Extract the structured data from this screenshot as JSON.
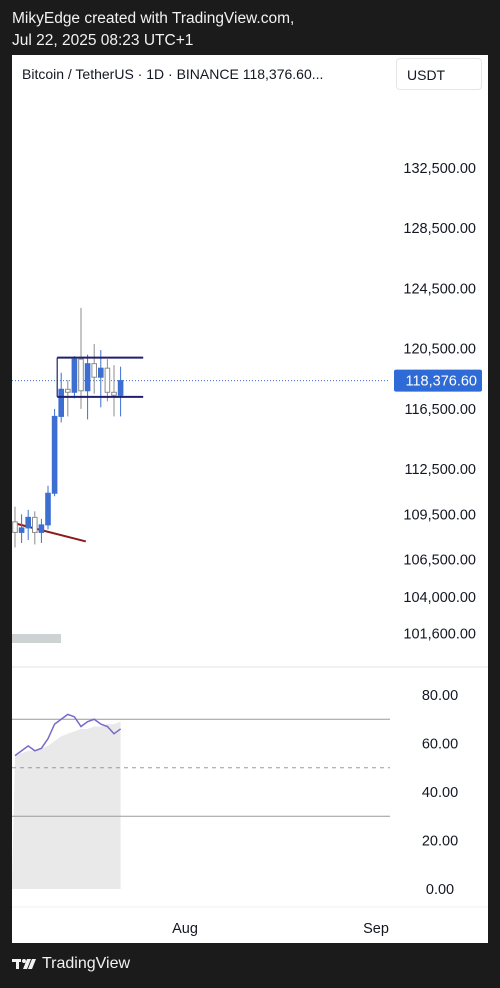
{
  "header": {
    "line1": "MikyEdge created with TradingView.com,",
    "line2": "Jul 22, 2025 08:23 UTC+1"
  },
  "chart_header": {
    "symbol": "Bitcoin / TetherUS · 1D · BINANCE  118,376.60...",
    "currency": "USDT"
  },
  "footer": {
    "brand": "TradingView"
  },
  "colors": {
    "up": "#3c6fd1",
    "down": "#8c8c8c",
    "rsi": "#7b68c8",
    "trendline": "#8b1a1a",
    "rectangle": "#1f1f6e",
    "price_label_bg": "#2f6bd6"
  },
  "chart_data": [
    {
      "type": "candlestick",
      "title": "Bitcoin / TetherUS · 1D · BINANCE",
      "ylim": [
        99500,
        137000
      ],
      "y_ticks": [
        "132,500.00",
        "128,500.00",
        "124,500.00",
        "120,500.00",
        "116,500.00",
        "112,500.00",
        "109,500.00",
        "106,500.00",
        "104,000.00",
        "101,600.00"
      ],
      "y_tick_values": [
        132500,
        128500,
        124500,
        120500,
        116500,
        112500,
        109500,
        106500,
        104000,
        101600
      ],
      "x_ticks": [
        "Aug",
        "Sep"
      ],
      "last_price": 118376.6,
      "last_price_label": "118,376.60",
      "candles": [
        {
          "o": 109000,
          "h": 110000,
          "l": 107300,
          "c": 108300
        },
        {
          "o": 108300,
          "h": 109500,
          "l": 107600,
          "c": 108600
        },
        {
          "o": 108600,
          "h": 109800,
          "l": 107800,
          "c": 109300
        },
        {
          "o": 109300,
          "h": 109700,
          "l": 107500,
          "c": 108300
        },
        {
          "o": 108300,
          "h": 109200,
          "l": 107600,
          "c": 108800
        },
        {
          "o": 108800,
          "h": 111400,
          "l": 108500,
          "c": 110900
        },
        {
          "o": 110900,
          "h": 116500,
          "l": 110700,
          "c": 116000
        },
        {
          "o": 116000,
          "h": 118900,
          "l": 115600,
          "c": 117800
        },
        {
          "o": 117800,
          "h": 118400,
          "l": 116000,
          "c": 117600
        },
        {
          "o": 117600,
          "h": 120000,
          "l": 117200,
          "c": 119800
        },
        {
          "o": 119800,
          "h": 123200,
          "l": 116500,
          "c": 117700
        },
        {
          "o": 117700,
          "h": 120100,
          "l": 115800,
          "c": 119500
        },
        {
          "o": 119500,
          "h": 120800,
          "l": 117500,
          "c": 118600
        },
        {
          "o": 118600,
          "h": 120400,
          "l": 116600,
          "c": 119200
        },
        {
          "o": 119200,
          "h": 119800,
          "l": 117000,
          "c": 117600
        },
        {
          "o": 117600,
          "h": 119400,
          "l": 116000,
          "c": 117400
        },
        {
          "o": 117400,
          "h": 119300,
          "l": 116000,
          "c": 118377
        }
      ],
      "rectangle": {
        "top": 119900,
        "bottom": 117300
      },
      "trendline": [
        {
          "i": 0,
          "y": 108900
        },
        {
          "i": 8,
          "y": 107700
        }
      ]
    },
    {
      "type": "line",
      "ylim": [
        0,
        80
      ],
      "y_ticks": [
        "80.00",
        "60.00",
        "40.00",
        "20.00",
        "0.00"
      ],
      "y_tick_values": [
        80,
        60,
        40,
        20,
        0
      ],
      "levels": [
        70,
        50,
        30
      ],
      "rsi": [
        55,
        57,
        59,
        57,
        58,
        62,
        68,
        70,
        72,
        71,
        67,
        69,
        70,
        68,
        67,
        64,
        66
      ],
      "rsi_ma": [
        55,
        56,
        57,
        57,
        58,
        59,
        61,
        63,
        64,
        65,
        66,
        66,
        67,
        67,
        68,
        68,
        69
      ]
    }
  ]
}
